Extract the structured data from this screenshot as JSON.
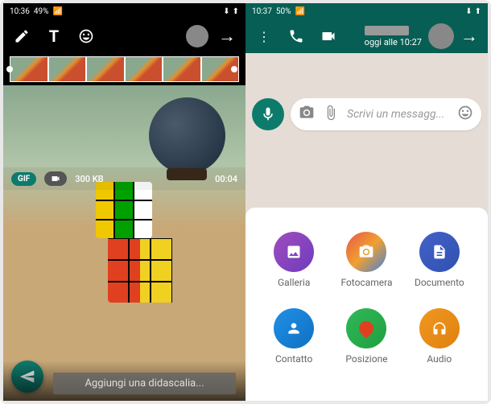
{
  "status_left": {
    "time": "10:36",
    "battery": "49%"
  },
  "status_right": {
    "time": "10:37",
    "battery": "50%"
  },
  "editor": {
    "gif_label": "GIF",
    "file_size": "300 KB",
    "duration": "00:04",
    "caption_placeholder": "Aggiungi una didascalia..."
  },
  "chat": {
    "last_seen": "oggi alle 10:27",
    "message_placeholder": "Scrivi un messagg..."
  },
  "attach_options": [
    {
      "label": "Galleria",
      "class": "c-gallery",
      "icon": "image"
    },
    {
      "label": "Fotocamera",
      "class": "c-camera",
      "icon": "camera"
    },
    {
      "label": "Documento",
      "class": "c-document",
      "icon": "document"
    },
    {
      "label": "Contatto",
      "class": "c-contact",
      "icon": "contact"
    },
    {
      "label": "Posizione",
      "class": "c-location",
      "icon": "location"
    },
    {
      "label": "Audio",
      "class": "c-audio",
      "icon": "audio"
    }
  ]
}
